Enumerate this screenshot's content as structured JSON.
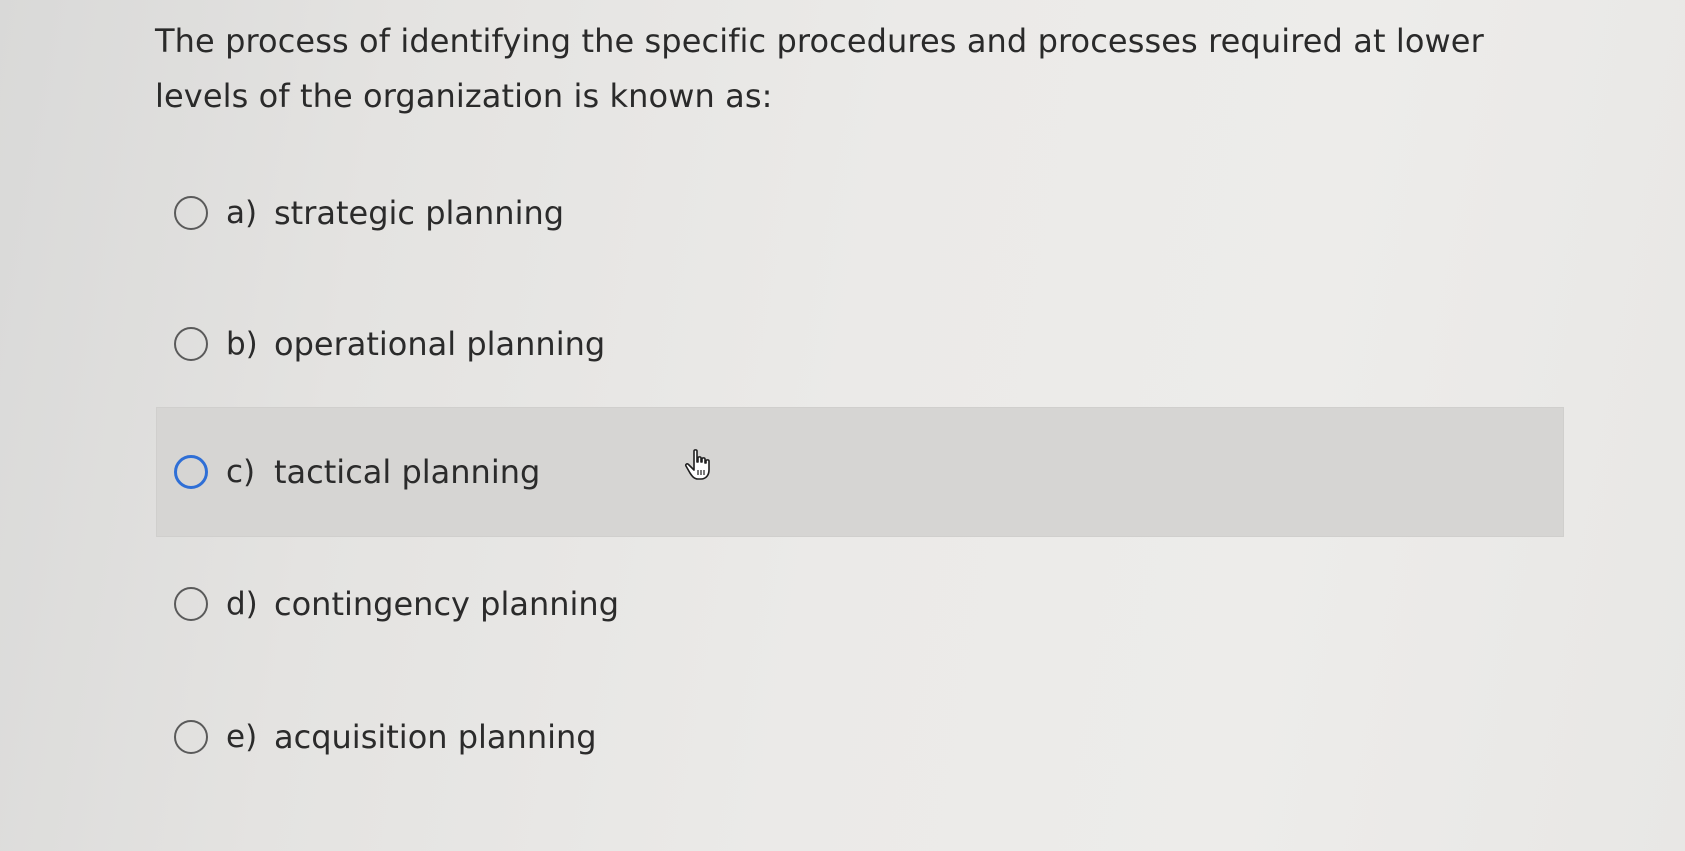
{
  "question": {
    "text": "The process of identifying the specific procedures and processes required at lower levels of the organization is known as:"
  },
  "options": [
    {
      "letter": "a)",
      "label": "strategic planning"
    },
    {
      "letter": "b)",
      "label": "operational planning"
    },
    {
      "letter": "c)",
      "label": "tactical planning",
      "hovered": true
    },
    {
      "letter": "d)",
      "label": "contingency planning"
    },
    {
      "letter": "e)",
      "label": "acquisition planning"
    }
  ],
  "colors": {
    "hover_background": "#d6d5d3",
    "hover_radio_border": "#2f6fd6",
    "radio_border": "#5a5a5a",
    "text": "#2b2b2b"
  },
  "icons": {
    "cursor": "pointer-hand-icon"
  }
}
